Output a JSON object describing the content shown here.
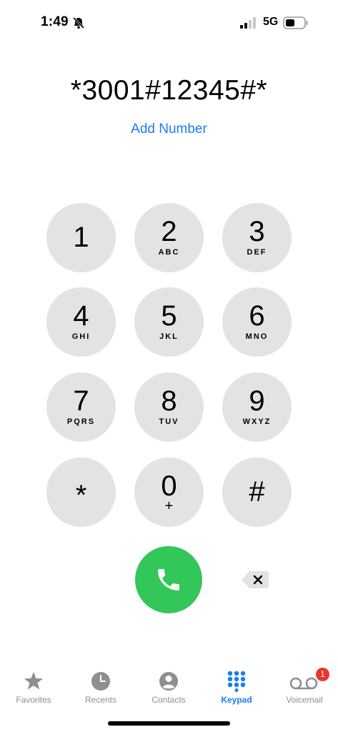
{
  "status_bar": {
    "time": "1:49",
    "network": "5G",
    "bell_icon": "bell-slash-icon",
    "signal_icon": "cellular-signal-icon",
    "battery_icon": "battery-icon"
  },
  "dialer": {
    "number": "*3001#12345#*",
    "add_number": "Add Number"
  },
  "keypad": {
    "keys": [
      {
        "digit": "1",
        "letters": ""
      },
      {
        "digit": "2",
        "letters": "ABC"
      },
      {
        "digit": "3",
        "letters": "DEF"
      },
      {
        "digit": "4",
        "letters": "GHI"
      },
      {
        "digit": "5",
        "letters": "JKL"
      },
      {
        "digit": "6",
        "letters": "MNO"
      },
      {
        "digit": "7",
        "letters": "PQRS"
      },
      {
        "digit": "8",
        "letters": "TUV"
      },
      {
        "digit": "9",
        "letters": "WXYZ"
      },
      {
        "digit": "*",
        "letters": ""
      },
      {
        "digit": "0",
        "letters": "+"
      },
      {
        "digit": "#",
        "letters": ""
      }
    ],
    "call_icon": "phone-icon",
    "delete_icon": "delete-backspace-icon"
  },
  "tabs": [
    {
      "label": "Favorites",
      "icon": "star-icon"
    },
    {
      "label": "Recents",
      "icon": "clock-icon"
    },
    {
      "label": "Contacts",
      "icon": "person-circle-icon"
    },
    {
      "label": "Keypad",
      "icon": "keypad-grid-icon"
    },
    {
      "label": "Voicemail",
      "icon": "voicemail-icon",
      "badge": "1"
    }
  ],
  "colors": {
    "accent": "#1a7df0",
    "call": "#33c659",
    "key_bg": "#e3e3e3",
    "badge": "#e8362d",
    "inactive": "#8e8e93"
  }
}
